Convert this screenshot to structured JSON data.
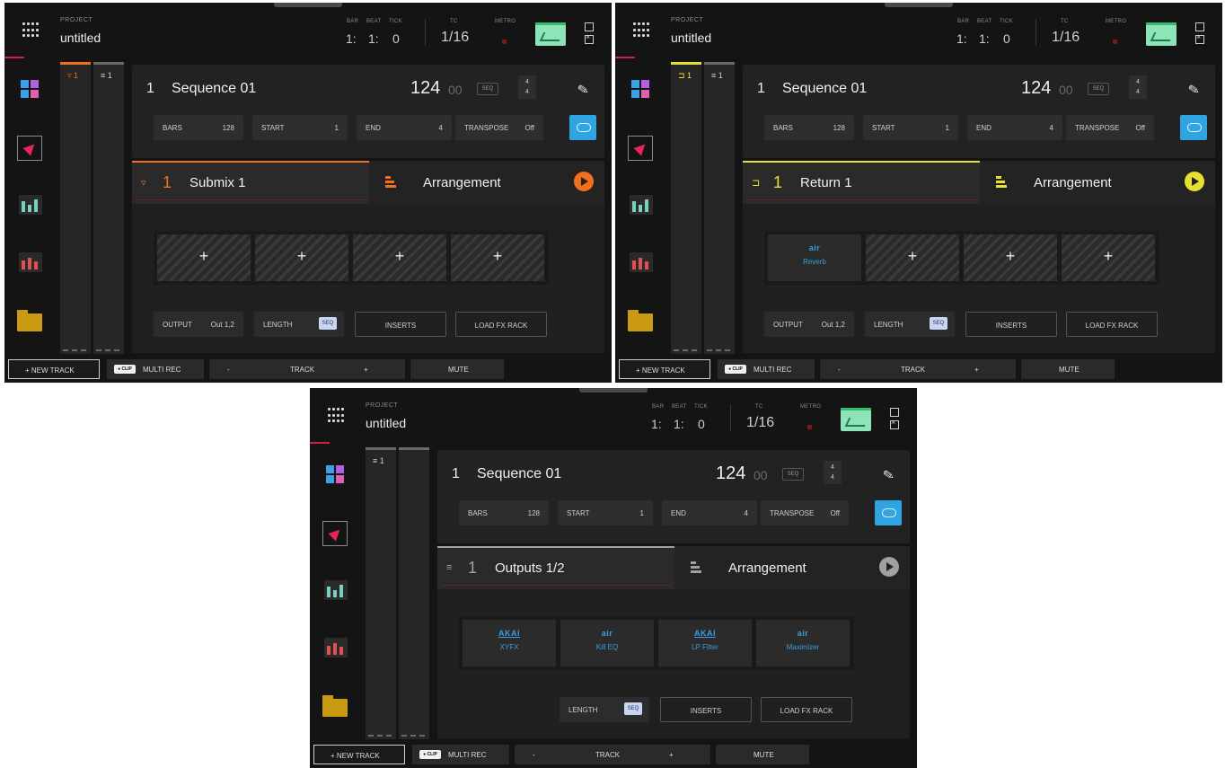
{
  "screens": [
    {
      "project_label": "PROJECT",
      "project_name": "untitled",
      "bar_label": "BAR",
      "beat_label": "BEAT",
      "tick_label": "TICK",
      "bar": "1:",
      "beat": "1:",
      "tick": "0",
      "tc_label": "TC",
      "tc_value": "1/16",
      "metro_label": "METRO",
      "col1_label": "▿ 1",
      "col2_label": "≡ 1",
      "seq_num": "1",
      "seq_name": "Sequence 01",
      "bpm": "124",
      "bpm_dec": "00",
      "seq_badge": "SEQ",
      "timesig_top": "4",
      "timesig_bot": "4",
      "bars_label": "BARS",
      "bars_value": "128",
      "start_label": "START",
      "start_value": "1",
      "end_label": "END",
      "end_value": "4",
      "transpose_label": "TRANSPOSE",
      "transpose_value": "Off",
      "track_icon": "▿",
      "track_num": "1",
      "track_name": "Submix 1",
      "arrangement_label": "Arrangement",
      "accent_color": "#f07020",
      "fx_slots": [
        {
          "brand": "",
          "plugin": "",
          "plus": "+"
        },
        {
          "brand": "",
          "plugin": "",
          "plus": "+"
        },
        {
          "brand": "",
          "plugin": "",
          "plus": "+"
        },
        {
          "brand": "",
          "plugin": "",
          "plus": "+"
        }
      ],
      "output_label": "OUTPUT",
      "output_value": "Out 1,2",
      "length_label": "LENGTH",
      "length_pill": "SEQ",
      "inserts_label": "INSERTS",
      "load_fx_label": "LOAD FX RACK",
      "new_track_label": "+ NEW TRACK",
      "clip_pill": "● CLIP",
      "multi_rec_label": "MULTI REC",
      "track_minus": "-",
      "track_label": "TRACK",
      "track_plus": "+",
      "mute_label": "MUTE"
    },
    {
      "project_label": "PROJECT",
      "project_name": "untitled",
      "bar_label": "BAR",
      "beat_label": "BEAT",
      "tick_label": "TICK",
      "bar": "1:",
      "beat": "1:",
      "tick": "0",
      "tc_label": "TC",
      "tc_value": "1/16",
      "metro_label": "METRO",
      "col1_label": "⊐ 1",
      "col2_label": "≡ 1",
      "seq_num": "1",
      "seq_name": "Sequence 01",
      "bpm": "124",
      "bpm_dec": "00",
      "seq_badge": "SEQ",
      "timesig_top": "4",
      "timesig_bot": "4",
      "bars_label": "BARS",
      "bars_value": "128",
      "start_label": "START",
      "start_value": "1",
      "end_label": "END",
      "end_value": "4",
      "transpose_label": "TRANSPOSE",
      "transpose_value": "Off",
      "track_icon": "⊐",
      "track_num": "1",
      "track_name": "Return 1",
      "arrangement_label": "Arrangement",
      "accent_color": "#e8e030",
      "fx_slots": [
        {
          "brand": "air",
          "plugin": "Reverb",
          "plus": ""
        },
        {
          "brand": "",
          "plugin": "",
          "plus": "+"
        },
        {
          "brand": "",
          "plugin": "",
          "plus": "+"
        },
        {
          "brand": "",
          "plugin": "",
          "plus": "+"
        }
      ],
      "output_label": "OUTPUT",
      "output_value": "Out 1,2",
      "length_label": "LENGTH",
      "length_pill": "SEQ",
      "inserts_label": "INSERTS",
      "load_fx_label": "LOAD FX RACK",
      "new_track_label": "+ NEW TRACK",
      "clip_pill": "● CLIP",
      "multi_rec_label": "MULTI REC",
      "track_minus": "-",
      "track_label": "TRACK",
      "track_plus": "+",
      "mute_label": "MUTE"
    },
    {
      "project_label": "PROJECT",
      "project_name": "untitled",
      "bar_label": "BAR",
      "beat_label": "BEAT",
      "tick_label": "TICK",
      "bar": "1:",
      "beat": "1:",
      "tick": "0",
      "tc_label": "TC",
      "tc_value": "1/16",
      "metro_label": "METRO",
      "col1_label": "≡ 1",
      "col2_label": "",
      "seq_num": "1",
      "seq_name": "Sequence 01",
      "bpm": "124",
      "bpm_dec": "00",
      "seq_badge": "SEQ",
      "timesig_top": "4",
      "timesig_bot": "4",
      "bars_label": "BARS",
      "bars_value": "128",
      "start_label": "START",
      "start_value": "1",
      "end_label": "END",
      "end_value": "4",
      "transpose_label": "TRANSPOSE",
      "transpose_value": "Off",
      "track_icon": "≡",
      "track_num": "1",
      "track_name": "Outputs 1/2",
      "arrangement_label": "Arrangement",
      "accent_color": "#a0a0a0",
      "fx_slots": [
        {
          "brand": "AKAI",
          "plugin": "XYFX",
          "plus": ""
        },
        {
          "brand": "air",
          "plugin": "Kill EQ",
          "plus": ""
        },
        {
          "brand": "AKAI",
          "plugin": "LP Filter",
          "plus": ""
        },
        {
          "brand": "air",
          "plugin": "Maximizer",
          "plus": ""
        }
      ],
      "output_label": "",
      "output_value": "",
      "length_label": "LENGTH",
      "length_pill": "SEQ",
      "inserts_label": "INSERTS",
      "load_fx_label": "LOAD FX RACK",
      "new_track_label": "+ NEW TRACK",
      "clip_pill": "● CLIP",
      "multi_rec_label": "MULTI REC",
      "track_minus": "-",
      "track_label": "TRACK",
      "track_plus": "+",
      "mute_label": "MUTE"
    }
  ],
  "icons": [
    "menu-grid-icon",
    "grid-view-icon",
    "arrow-mode-icon",
    "mixer-icon",
    "channel-mixer-icon",
    "browser-folder-icon",
    "pencil-icon",
    "loop-icon",
    "play-icon",
    "arrangement-icon",
    "automation-icon"
  ]
}
